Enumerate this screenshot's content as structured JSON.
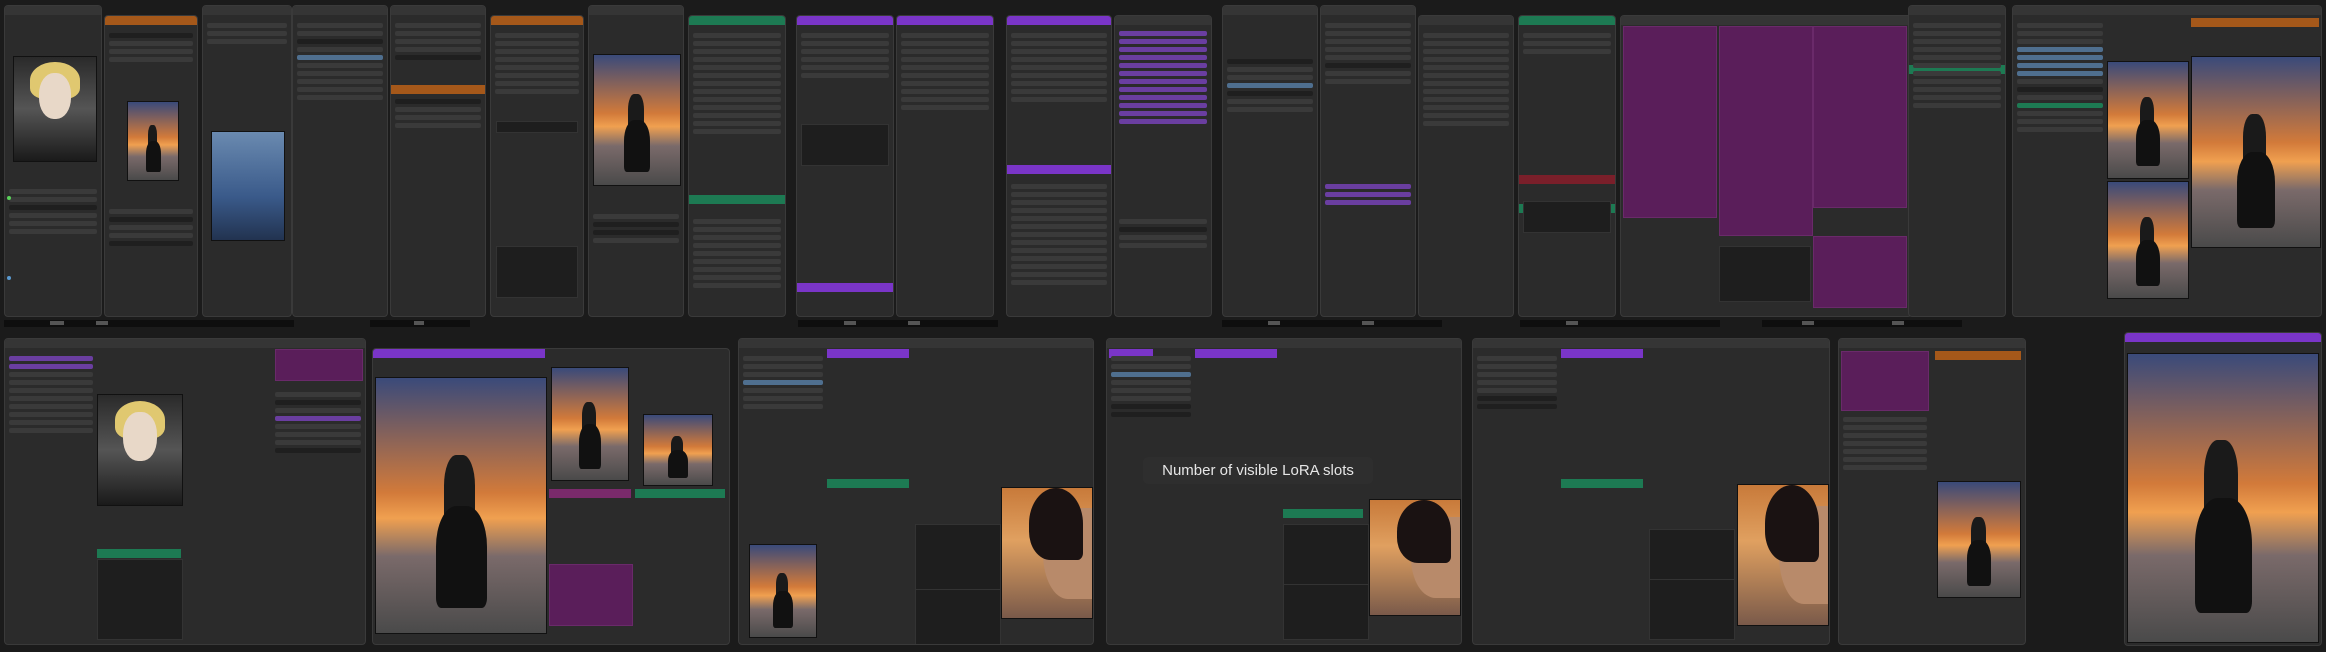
{
  "tooltip": {
    "text": "Number of visible LoRA slots"
  },
  "colors": {
    "canvas": "#1b1b1b",
    "node": "#2b2b2b",
    "orange_header": "#a5581a",
    "green_header": "#1d7a53",
    "purple_header": "#7a35c8",
    "magenta_header": "#7a2a6b"
  },
  "icons": [
    "slot-dot-icon"
  ]
}
